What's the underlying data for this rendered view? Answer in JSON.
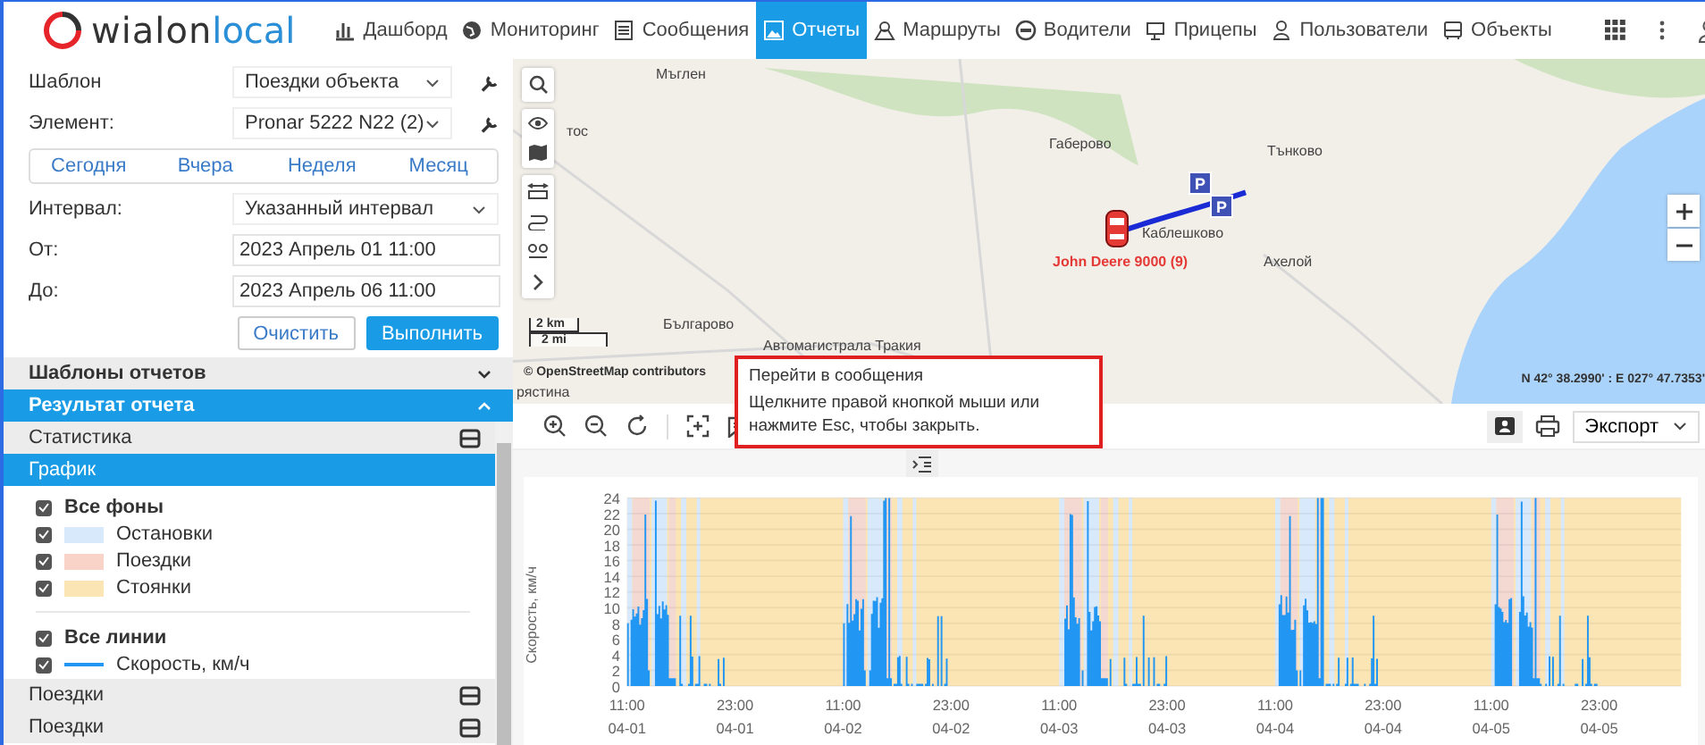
{
  "header": {
    "logo": {
      "brand": "wialon",
      "product": "local"
    },
    "nav": [
      {
        "label": "Дашборд",
        "selected": false
      },
      {
        "label": "Мониторинг",
        "selected": false
      },
      {
        "label": "Сообщения",
        "selected": false
      },
      {
        "label": "Отчеты",
        "selected": true
      },
      {
        "label": "Маршруты",
        "selected": false
      },
      {
        "label": "Водители",
        "selected": false
      },
      {
        "label": "Прицепы",
        "selected": false
      },
      {
        "label": "Пользователи",
        "selected": false
      },
      {
        "label": "Объекты",
        "selected": false
      }
    ]
  },
  "form": {
    "template": {
      "label": "Шаблон",
      "value": "Поездки объекта"
    },
    "element": {
      "label": "Элемент:",
      "value": "Pronar 5222 N22 (2)"
    },
    "periods": [
      {
        "label": "Сегодня",
        "selected": false
      },
      {
        "label": "Вчера",
        "selected": false
      },
      {
        "label": "Неделя",
        "selected": false
      },
      {
        "label": "Месяц",
        "selected": false
      }
    ],
    "interval": {
      "label": "Интервал:",
      "value": "Указанный интервал"
    },
    "from": {
      "label": "От:",
      "value": "2023 Апрель 01 11:00"
    },
    "to": {
      "label": "До:",
      "value": "2023 Апрель 06 11:00"
    },
    "buttons": [
      {
        "label": "Очистить",
        "kind": "secondary"
      },
      {
        "label": "Выполнить",
        "kind": "primary"
      }
    ]
  },
  "sections": [
    {
      "title": "Шаблоны отчетов",
      "expanded": false
    },
    {
      "title": "Результат отчета",
      "expanded": true
    }
  ],
  "result_items": [
    {
      "label": "Статистика",
      "selected": false
    },
    {
      "label": "График",
      "selected": true
    },
    {
      "label": "Поездки",
      "selected": false
    },
    {
      "label": "Поездки",
      "selected": false
    }
  ],
  "legend": [
    {
      "label": "Все фоны",
      "checked": true,
      "items": [
        {
          "label": "Остановки",
          "checked": true,
          "kind": "swatch",
          "color": "#d8e9fb"
        },
        {
          "label": "Поездки",
          "checked": true,
          "kind": "swatch",
          "color": "#f9d3c8"
        },
        {
          "label": "Стоянки",
          "checked": true,
          "kind": "swatch",
          "color": "#fbe5b4"
        }
      ]
    },
    {
      "label": "Все линии",
      "checked": true,
      "items": [
        {
          "label": "Скорость, км/ч",
          "checked": true,
          "kind": "line",
          "color": "#2196f3"
        }
      ]
    }
  ],
  "map": {
    "places": [
      "Мъглен",
      "тос",
      "Габерово",
      "Тънково",
      "Каблешково",
      "Ахелой",
      "Българово",
      "Автомагистрала Тракия",
      "рястина"
    ],
    "parking": [
      "P",
      "P"
    ],
    "unit_label": "John Deere 9000 (9)",
    "scale": [
      "2 km",
      "2 mi"
    ],
    "attribution": "© OpenStreetMap contributors",
    "coordinates": "N 42° 38.2990' : E 027° 47.7353'"
  },
  "tooltip": {
    "title": "Перейти в сообщения",
    "text": "Щелкните правой кнопкой мыши или нажмите Esc, чтобы закрыть."
  },
  "chart_toolbar": {
    "export": "Экспорт"
  },
  "chart": {
    "ylabel": "Скорость, км/ч",
    "yticks": [
      "24",
      "22",
      "20",
      "18",
      "16",
      "14",
      "12",
      "10",
      "8",
      "6",
      "4",
      "2",
      "0"
    ],
    "xticks": [
      {
        "time": "11:00",
        "date": "04-01"
      },
      {
        "time": "23:00",
        "date": "04-01"
      },
      {
        "time": "11:00",
        "date": "04-02"
      },
      {
        "time": "23:00",
        "date": "04-02"
      },
      {
        "time": "11:00",
        "date": "04-03"
      },
      {
        "time": "23:00",
        "date": "04-03"
      },
      {
        "time": "11:00",
        "date": "04-04"
      },
      {
        "time": "23:00",
        "date": "04-04"
      },
      {
        "time": "11:00",
        "date": "04-05"
      },
      {
        "time": "23:00",
        "date": "04-05"
      }
    ]
  }
}
